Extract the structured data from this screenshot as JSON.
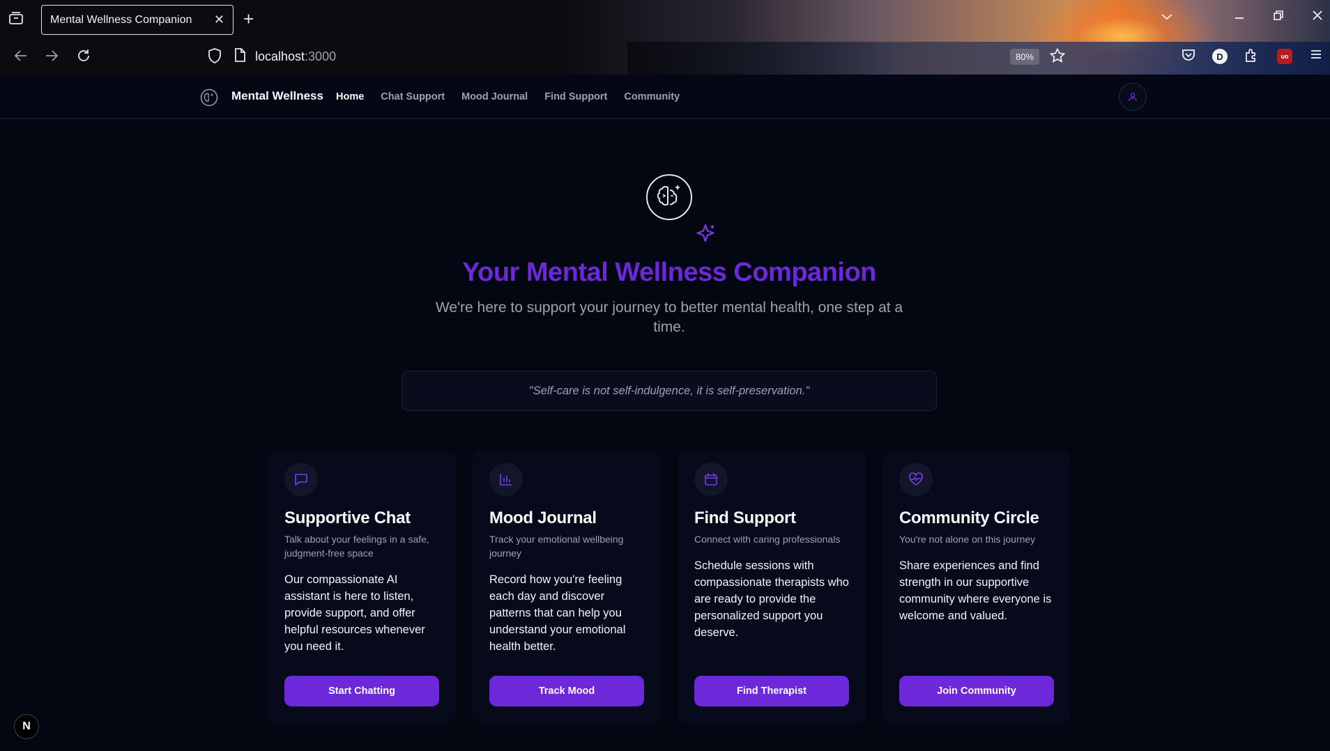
{
  "browser": {
    "tab_title": "Mental Wellness Companion",
    "url_host": "localhost",
    "url_port": ":3000",
    "zoom": "80%"
  },
  "header": {
    "brand": "Mental Wellness",
    "nav": [
      "Home",
      "Chat Support",
      "Mood Journal",
      "Find Support",
      "Community"
    ],
    "active": "Home"
  },
  "hero": {
    "title": "Your Mental Wellness Companion",
    "subtitle": "We're here to support your journey to better mental health, one step at a time.",
    "quote": "\"Self-care is not self-indulgence, it is self-preservation.\""
  },
  "cards": [
    {
      "icon": "chat-icon",
      "title": "Supportive Chat",
      "desc": "Talk about your feelings in a safe, judgment-free space",
      "body": "Our compassionate AI assistant is here to listen, provide support, and offer helpful resources whenever you need it.",
      "button": "Start Chatting"
    },
    {
      "icon": "bar-chart-icon",
      "title": "Mood Journal",
      "desc": "Track your emotional wellbeing journey",
      "body": "Record how you're feeling each day and discover patterns that can help you understand your emotional health better.",
      "button": "Track Mood"
    },
    {
      "icon": "calendar-icon",
      "title": "Find Support",
      "desc": "Connect with caring professionals",
      "body": "Schedule sessions with compassionate therapists who are ready to provide the personalized support you deserve.",
      "button": "Find Therapist"
    },
    {
      "icon": "heart-pulse-icon",
      "title": "Community Circle",
      "desc": "You're not alone on this journey",
      "body": "Share experiences and find strength in our supportive community where everyone is welcome and valued.",
      "button": "Join Community"
    }
  ],
  "colors": {
    "accent": "#6d28d9",
    "background": "#030712",
    "muted_text": "#9ca3af"
  },
  "dev_badge": "N"
}
